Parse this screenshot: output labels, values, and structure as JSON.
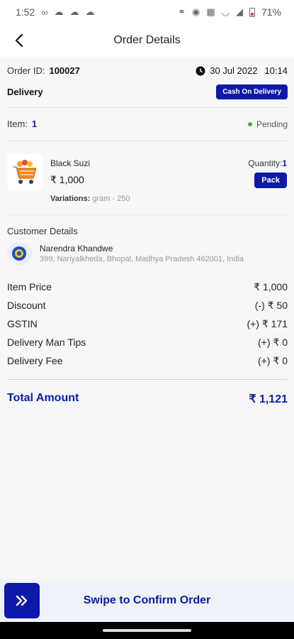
{
  "status_bar": {
    "time": "1:52",
    "battery": "71%",
    "left_icons": [
      "infinity-icon",
      "cloud-icon",
      "cloud-icon",
      "cloud-icon"
    ],
    "right_icons": [
      "link-icon",
      "eye-icon",
      "wifi-icon",
      "wifi-icon",
      "signal-icon"
    ]
  },
  "header": {
    "title": "Order Details"
  },
  "order": {
    "id_label": "Order ID:",
    "id_value": "100027",
    "date": "30 Jul 2022",
    "time": "10:14",
    "delivery_label": "Delivery",
    "payment_badge": "Cash On Delivery"
  },
  "items": {
    "label": "Item:",
    "count": "1",
    "status": "Pending"
  },
  "product": {
    "name": "Black Suzi",
    "price": "₹ 1,000",
    "quantity_label": "Quantity:",
    "quantity_value": "1",
    "pack_label": "Pack",
    "variations_label": "Variations:",
    "variations_value": "gram - 250"
  },
  "customer": {
    "section_title": "Customer Details",
    "name": "Narendra Khandwe",
    "address": "399, Nariyalkheda, Bhopal, Madhya Pradesh 462001, India"
  },
  "pricing": [
    {
      "label": "Item Price",
      "value": "₹ 1,000"
    },
    {
      "label": "Discount",
      "value": "(-) ₹ 50"
    },
    {
      "label": "GSTIN",
      "value": "(+) ₹ 171"
    },
    {
      "label": "Delivery Man Tips",
      "value": "(+) ₹ 0"
    },
    {
      "label": "Delivery Fee",
      "value": "(+) ₹ 0"
    }
  ],
  "total": {
    "label": "Total Amount",
    "value": "₹ 1,121"
  },
  "swipe": {
    "label": "Swipe to Confirm Order"
  },
  "colors": {
    "accent": "#0d1aa8",
    "pending": "#3bb34a"
  }
}
